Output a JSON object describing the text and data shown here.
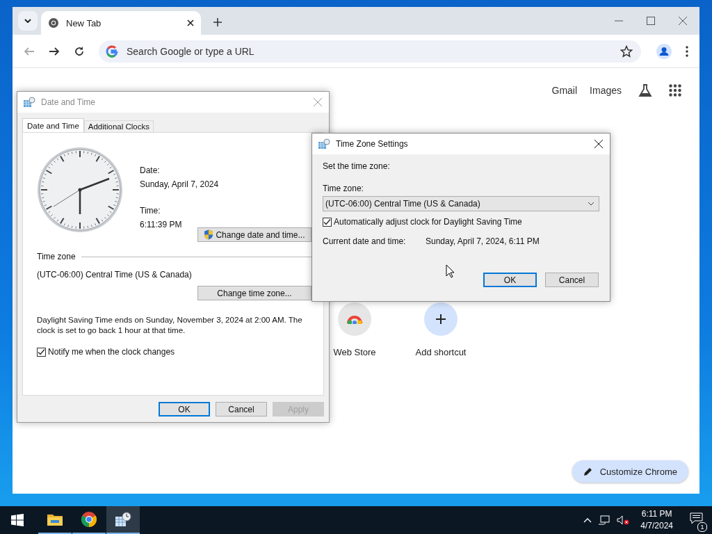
{
  "browser": {
    "tabs": [
      {
        "title": "New Tab",
        "selected": true
      }
    ],
    "omnibox": {
      "placeholder": "Search Google or type a URL"
    },
    "header_links": [
      "Gmail",
      "Images"
    ],
    "shortcuts": [
      {
        "label": "Web Store",
        "kind": "store"
      },
      {
        "label": "Add shortcut",
        "kind": "add"
      }
    ],
    "customize_button": "Customize Chrome"
  },
  "date_time_dialog": {
    "title": "Date and Time",
    "active": false,
    "tabs": [
      {
        "label": "Date and Time",
        "selected": true
      },
      {
        "label": "Additional Clocks",
        "selected": false
      }
    ],
    "date_label": "Date:",
    "date": "Sunday, April 7, 2024",
    "time_label": "Time:",
    "time": "6:11:39 PM",
    "change_datetime_button": "Change date and time...",
    "time_zone_heading": "Time zone",
    "time_zone": "(UTC-06:00) Central Time (US & Canada)",
    "change_timezone_button": "Change time zone...",
    "dst_note": "Daylight Saving Time ends on Sunday, November 3, 2024 at 2:00 AM. The clock is set to go back 1 hour at that time.",
    "notify": {
      "label": "Notify me when the clock changes",
      "checked": true
    },
    "buttons": [
      {
        "label": "OK",
        "kind": "default",
        "disabled": false
      },
      {
        "label": "Cancel",
        "kind": "normal",
        "disabled": false
      },
      {
        "label": "Apply",
        "kind": "normal",
        "disabled": true
      }
    ]
  },
  "time_zone_dialog": {
    "title": "Time Zone Settings",
    "active": true,
    "intro": "Set the time zone:",
    "zone_label": "Time zone:",
    "zone_value": "(UTC-06:00) Central Time (US & Canada)",
    "auto_dst": {
      "label": "Automatically adjust clock for Daylight Saving Time",
      "checked": true
    },
    "current_label": "Current date and time:",
    "current_value": "Sunday, April 7, 2024, 6:11 PM",
    "buttons": [
      {
        "label": "OK",
        "kind": "default",
        "disabled": false
      },
      {
        "label": "Cancel",
        "kind": "normal",
        "disabled": false
      }
    ]
  },
  "taskbar": {
    "apps": [
      {
        "kind": "explorer",
        "active": false
      },
      {
        "kind": "chrome",
        "active": false
      },
      {
        "kind": "clock",
        "active": true
      }
    ],
    "clock_time": "6:11 PM",
    "clock_date": "4/7/2024",
    "notification_count": "1"
  }
}
